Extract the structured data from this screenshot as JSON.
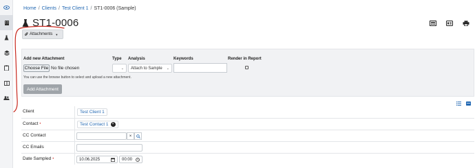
{
  "sidebar": {
    "items": [
      {
        "icon": "eye-icon",
        "active": false
      },
      {
        "icon": "building-icon",
        "active": true
      },
      {
        "icon": "flask-icon",
        "active": false
      },
      {
        "icon": "layers-icon",
        "active": false
      },
      {
        "icon": "clipboard-icon",
        "active": false
      },
      {
        "icon": "book-icon",
        "active": false
      },
      {
        "icon": "users-icon",
        "active": false
      }
    ]
  },
  "breadcrumb": {
    "home": "Home",
    "sep": "/",
    "clients": "Clients",
    "client": "Test Client 1",
    "current": "ST1-0006 (Sample)"
  },
  "page": {
    "title": "ST1-0006",
    "attachments_button": "Attachments"
  },
  "attachment_form": {
    "heading": "Add new Attachment",
    "type_label": "Type",
    "analysis_label": "Analysis",
    "keywords_label": "Keywords",
    "render_label": "Render in Report",
    "choose_file": "Choose File",
    "no_file": "No file chosen",
    "analysis_value": "Attach to Sample",
    "hint": "You can use the browse button to select and upload a new attachment.",
    "add_button": "Add Attachment"
  },
  "fields": {
    "client_label": "Client",
    "client_value": "Test Client 1",
    "contact_label": "Contact",
    "contact_value": "Test Contact 1",
    "cc_contact_label": "CC Contact",
    "cc_emails_label": "CC Emails",
    "date_sampled_label": "Date Sampled",
    "date_value": "10.06.2025",
    "time_value": "00:00",
    "required_marker": "•"
  },
  "colors": {
    "link": "#2469b3",
    "annotation": "#c8281e"
  }
}
